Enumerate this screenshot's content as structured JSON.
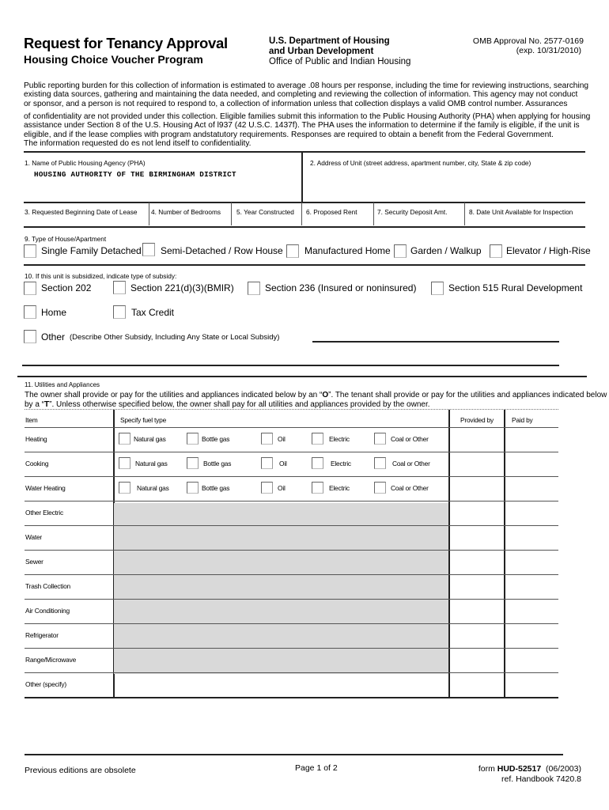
{
  "header": {
    "title": "Request for Tenancy Approval",
    "subtitle": "Housing Choice Voucher Program",
    "dept_line1": "U.S. Department of Housing",
    "dept_line2": "and Urban Development",
    "dept_line3": "Office of Public and Indian Housing",
    "omb_line1": "OMB Approval No. 2577-0169",
    "omb_line2": "(exp. 10/31/2010)"
  },
  "notice": {
    "lines_a": [
      "Public reporting burden for this collection of information is estimated to average .08 hours per response, including the time for reviewing instructions, searching",
      "existing data sources, gathering and maintaining the data needed, and completing and reviewing the collection of information.  This agency may not conduct",
      "or sponsor, and a person is not required to respond to, a collection of information unless that collection displays a valid OMB control number.  Assurances"
    ],
    "lines_b": [
      "of confidentiality are not provided under this collection.  Eligible families submit this information to the Public Housing Authority (PHA) when applying for housing",
      "assistance under Section 8 of the U.S. Housing Act of l937 (42 U.S.C. 1437f). The PHA uses the information  to determine if the family is eligible, if the unit is",
      "eligible, and if the lease complies with program andstatutory requirements. Responses are required to obtain a benefit from the Federal Government.",
      "The information requested do  es not lend itself to confidentiality."
    ]
  },
  "fields": {
    "f1_label": "1. Name of Public Housing Agency (PHA)",
    "f1_value": "HOUSING AUTHORITY OF THE BIRMINGHAM DISTRICT",
    "f2_label": "2. Address of Unit  (street address, apartment number, city, State & zip code)",
    "f2_value": "",
    "f3_label": "3. Requested Beginning Date of Lease",
    "f4_label": "4.   Number of Bedrooms",
    "f5_label": "5. Year Constructed",
    "f6_label": "6.  Proposed Rent",
    "f7_label": "7.  Security Deposit Amt.",
    "f8_label": "8. Date Unit Available for Inspection"
  },
  "section9": {
    "label": "9.  Type of House/Apartment",
    "options": [
      "Single Family Detached",
      "Semi-Detached / Row House",
      "Manufactured Home",
      "Garden / Walkup",
      "Elevator / High-Rise"
    ]
  },
  "section10": {
    "label": "10. If this unit is subsidized, indicate type of subsidy:",
    "options": [
      "Section 202",
      "Section 221(d)(3)(BMIR)",
      "Section 236 (Insured or noninsured)",
      "Section 515 Rural Development",
      "Home",
      "Tax Credit"
    ],
    "other_label": "Other",
    "other_desc": "(Describe Other Subsidy, Including Any State or Local Subsidy)",
    "other_value": ""
  },
  "section11": {
    "label": "11. Utilities and Appliances",
    "intro_line1_pre": "The owner shall provide or pay for the utilities and appliances indicated below by an “",
    "intro_owner_mark": "O",
    "intro_line1_post": "”.  The tenant shall provide or pay for the utilities and appliances indicated below",
    "intro_line2_pre": "by a “",
    "intro_tenant_mark": "T",
    "intro_line2_post": "”.  Unless otherwise specified below, the owner shall pay for all utilities and appliances provided by the owner.",
    "col_item": "Item",
    "col_fuel": "Specify fuel type",
    "col_provided": "Provided by",
    "col_paid": "Paid by",
    "fuel_types": [
      "Natural gas",
      "Bottle gas",
      "Oil",
      "Electric",
      "Coal or Other"
    ],
    "rows": [
      {
        "item": "Heating"
      },
      {
        "item": "Cooking"
      },
      {
        "item": "Water Heating"
      },
      {
        "item": "Other Electric"
      },
      {
        "item": "Water"
      },
      {
        "item": "Sewer"
      },
      {
        "item": "Trash Collection"
      },
      {
        "item": "Air Conditioning"
      },
      {
        "item": "Refrigerator"
      },
      {
        "item": "Range/Microwave"
      },
      {
        "item": "Other (specify)"
      }
    ]
  },
  "footer": {
    "left": "Previous editions are obsolete",
    "center": "Page 1 of 2",
    "form_prefix": "form ",
    "form_number": "HUD-52517",
    "form_date": "  (06/2003)",
    "ref": "ref. Handbook 7420.8"
  },
  "colors": {
    "shade": "#d9d9d9",
    "rule": "#222222"
  }
}
